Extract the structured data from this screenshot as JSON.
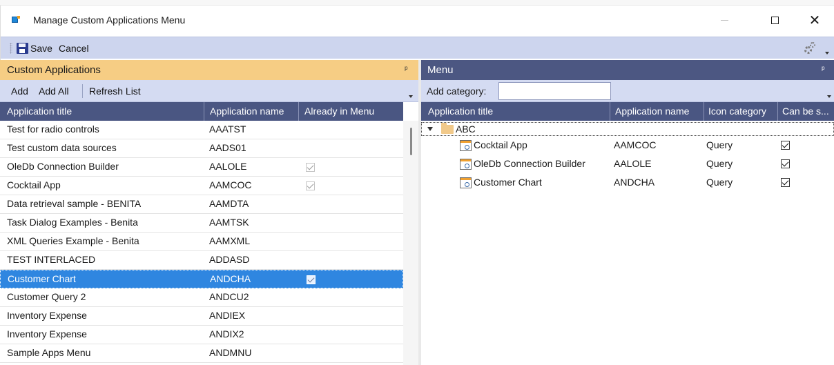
{
  "window": {
    "title": "Manage Custom Applications Menu",
    "min_glyph": "—",
    "close_glyph": "✕"
  },
  "toolbar": {
    "save_label": "Save",
    "cancel_label": "Cancel"
  },
  "left_pane": {
    "title": "Custom Applications",
    "pin_glyph": "🖈",
    "buttons": {
      "add": "Add",
      "add_all": "Add All",
      "refresh": "Refresh List"
    },
    "columns": [
      "Application title",
      "Application name",
      "Already in Menu"
    ],
    "rows": [
      {
        "title": "Test for radio controls",
        "name": "AAATST",
        "in_menu": false
      },
      {
        "title": "Test custom data sources",
        "name": "AADS01",
        "in_menu": false
      },
      {
        "title": "OleDb Connection Builder",
        "name": "AALOLE",
        "in_menu": true
      },
      {
        "title": "Cocktail App",
        "name": "AAMCOC",
        "in_menu": true
      },
      {
        "title": "Data retrieval sample - BENITA",
        "name": "AAMDTA",
        "in_menu": false
      },
      {
        "title": "Task Dialog Examples - Benita",
        "name": "AAMTSK",
        "in_menu": false
      },
      {
        "title": "XML Queries Example  - Benita",
        "name": "AAMXML",
        "in_menu": false
      },
      {
        "title": "TEST INTERLACED",
        "name": "ADDASD",
        "in_menu": false
      },
      {
        "title": "Customer Chart",
        "name": "ANDCHA",
        "in_menu": true,
        "selected": true
      },
      {
        "title": "Customer Query 2",
        "name": "ANDCU2",
        "in_menu": false
      },
      {
        "title": "Inventory Expense",
        "name": "ANDIEX",
        "in_menu": false
      },
      {
        "title": "Inventory Expense",
        "name": "ANDIX2",
        "in_menu": false
      },
      {
        "title": "Sample Apps Menu",
        "name": "ANDMNU",
        "in_menu": false
      }
    ]
  },
  "right_pane": {
    "title": "Menu",
    "pin_glyph": "🖈",
    "add_category_label": "Add category:",
    "add_category_value": "",
    "columns": [
      "Application title",
      "Application name",
      "Icon category",
      "Can be s..."
    ],
    "category": "ABC",
    "items": [
      {
        "title": "Cocktail App",
        "name": "AAMCOC",
        "icon_category": "Query",
        "can_be": true
      },
      {
        "title": "OleDb Connection Builder",
        "name": "AALOLE",
        "icon_category": "Query",
        "can_be": true
      },
      {
        "title": "Customer Chart",
        "name": "ANDCHA",
        "icon_category": "Query",
        "can_be": true
      }
    ]
  },
  "colors": {
    "left_header": "#f6cd84",
    "right_header": "#4c5782",
    "toolbar": "#cdd5ee",
    "selection": "#2f86e0"
  }
}
